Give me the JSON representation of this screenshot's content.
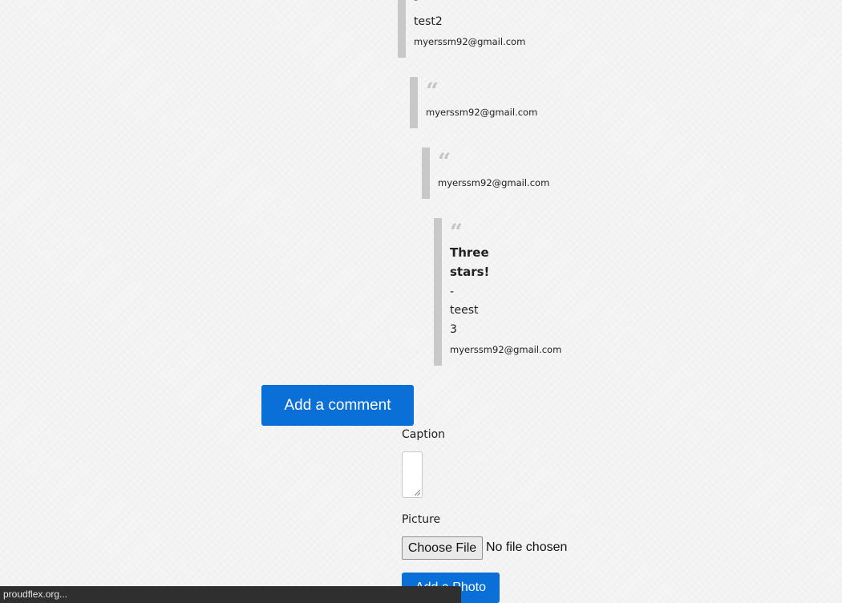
{
  "comments": [
    {
      "dash": "-",
      "body": "test2",
      "email": "myerssm92@gmail.com"
    },
    {
      "quote_icon": "quote-icon",
      "email": "myerssm92@gmail.com"
    },
    {
      "quote_icon": "quote-icon",
      "email": "myerssm92@gmail.com"
    },
    {
      "quote_icon": "quote-icon",
      "title_line1": "Three",
      "title_line2": "stars!",
      "dash": "-",
      "body": "teest",
      "rating": "3",
      "email": "myerssm92@gmail.com"
    }
  ],
  "add_comment_label": "Add a comment",
  "form": {
    "caption_label": "Caption",
    "caption_value": "",
    "picture_label": "Picture",
    "choose_file_label": "Choose File",
    "file_status": "No file chosen",
    "submit_label": "Add a Photo"
  },
  "status_bar": {
    "url": "proudflex.org..."
  },
  "colors": {
    "primary": "#0a6fd6",
    "comment_border": "#c8c8c8",
    "quote": "#c4c4c4"
  }
}
